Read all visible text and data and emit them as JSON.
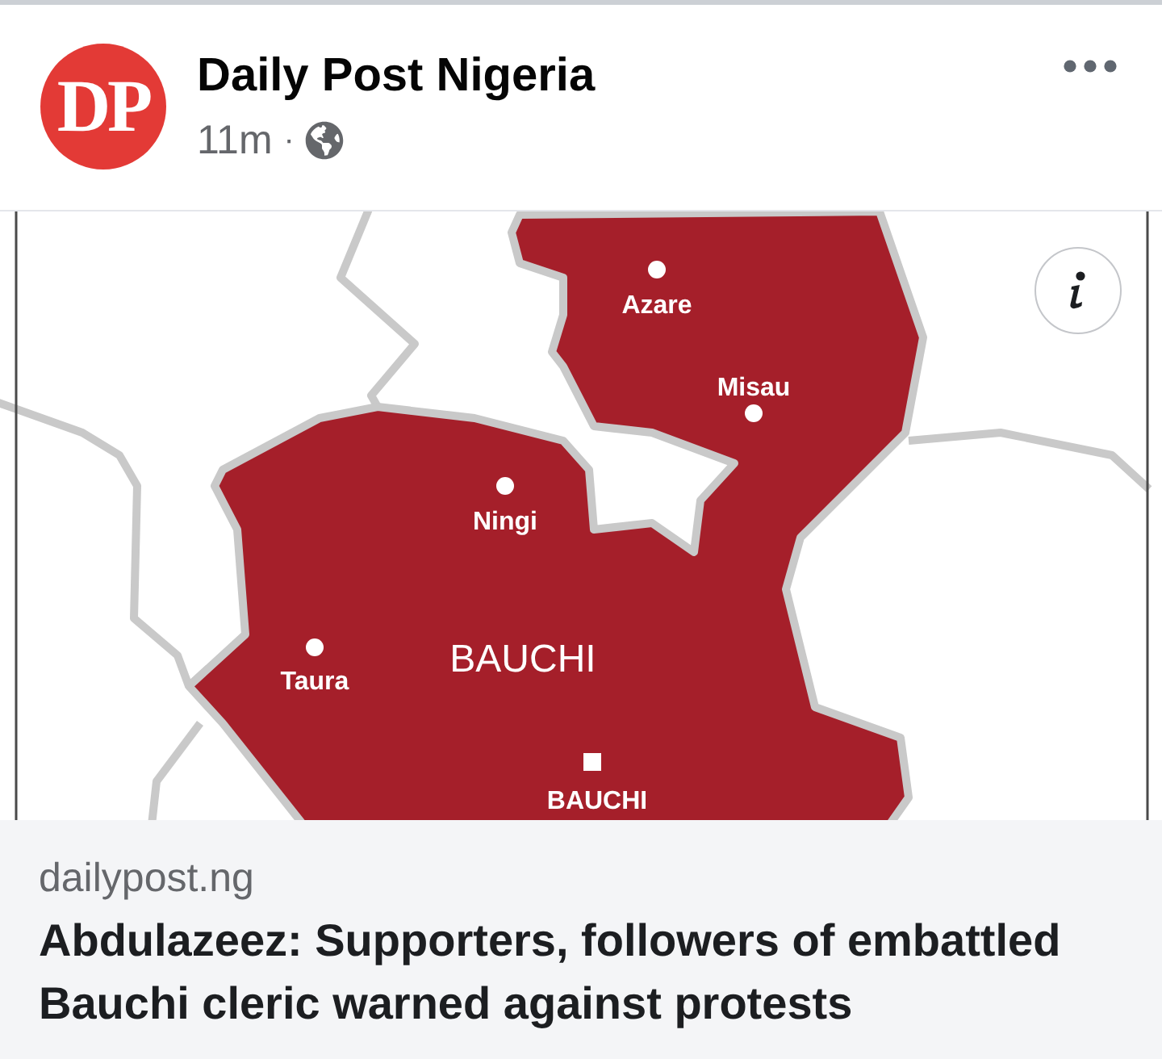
{
  "post": {
    "avatar_text": "DP",
    "page_name": "Daily Post Nigeria",
    "time": "11m",
    "separator": "·"
  },
  "map": {
    "places": [
      {
        "name": "Azare",
        "kind": "town"
      },
      {
        "name": "Misau",
        "kind": "town"
      },
      {
        "name": "Ningi",
        "kind": "town"
      },
      {
        "name": "Taura",
        "kind": "town"
      },
      {
        "name": "BAUCHI",
        "kind": "state"
      },
      {
        "name": "BAUCHI",
        "kind": "capital"
      }
    ]
  },
  "link": {
    "domain": "dailypost.ng",
    "title": "Abdulazeez: Supporters, followers of embattled Bauchi cleric warned against protests"
  }
}
